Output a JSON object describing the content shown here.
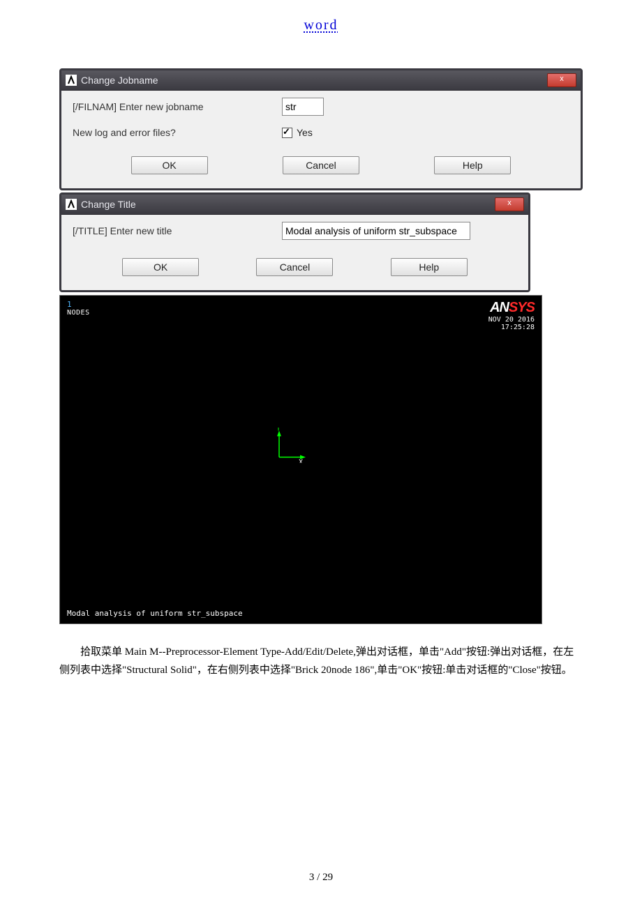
{
  "header_link": "word",
  "dialog1": {
    "title": "Change Jobname",
    "label_jobname": "[/FILNAM] Enter new jobname",
    "value_jobname": "str",
    "label_newlog": "New log and error files?",
    "checkbox_label": "Yes",
    "btn_ok": "OK",
    "btn_cancel": "Cancel",
    "btn_help": "Help",
    "close_glyph": "x"
  },
  "dialog2": {
    "title": "Change Title",
    "label_title": "[/TITLE]  Enter new title",
    "value_title": "Modal analysis of uniform str_subspace",
    "btn_ok": "OK",
    "btn_cancel": "Cancel",
    "btn_help": "Help",
    "close_glyph": "x"
  },
  "ansys": {
    "window_num": "1",
    "nodes_label": "NODES",
    "logo_an": "AN",
    "logo_sys": "SYS",
    "date": "NOV 20 2016",
    "time": "17:25:28",
    "axis_y": "Y",
    "axis_x": "X",
    "footer": "Modal analysis of uniform str_subspace"
  },
  "paragraph": "拾取菜单 Main M--Preprocessor-Element Type-Add/Edit/Delete,弹出对话框，单击\"Add\"按钮:弹出对话框，在左侧列表中选择\"Structural Solid\"，在右侧列表中选择\"Brick 20node 186\",单击\"OK\"按钮:单击对话框的\"Close\"按钮。",
  "page_footer": "3  / 29"
}
